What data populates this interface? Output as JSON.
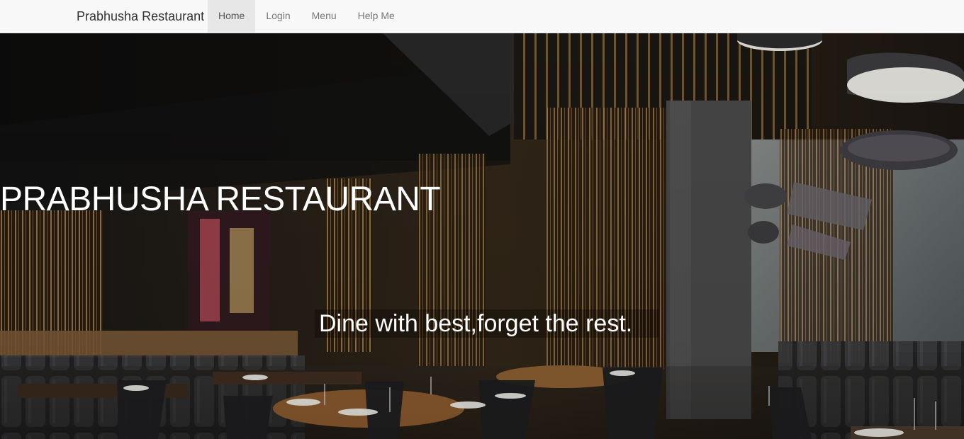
{
  "navbar": {
    "brand": "Prabhusha Restaurant",
    "items": [
      {
        "label": "Home",
        "active": true
      },
      {
        "label": "Login",
        "active": false
      },
      {
        "label": "Menu",
        "active": false
      },
      {
        "label": "Help Me",
        "active": false
      }
    ],
    "colors": {
      "background": "#f8f8f8",
      "active_background": "#e7e7e7",
      "text": "#777777"
    }
  },
  "hero": {
    "title": "PRABHUSHA RESTAURANT",
    "tagline": "Dine with best,forget the rest.",
    "image": "restaurant-interior-image"
  }
}
